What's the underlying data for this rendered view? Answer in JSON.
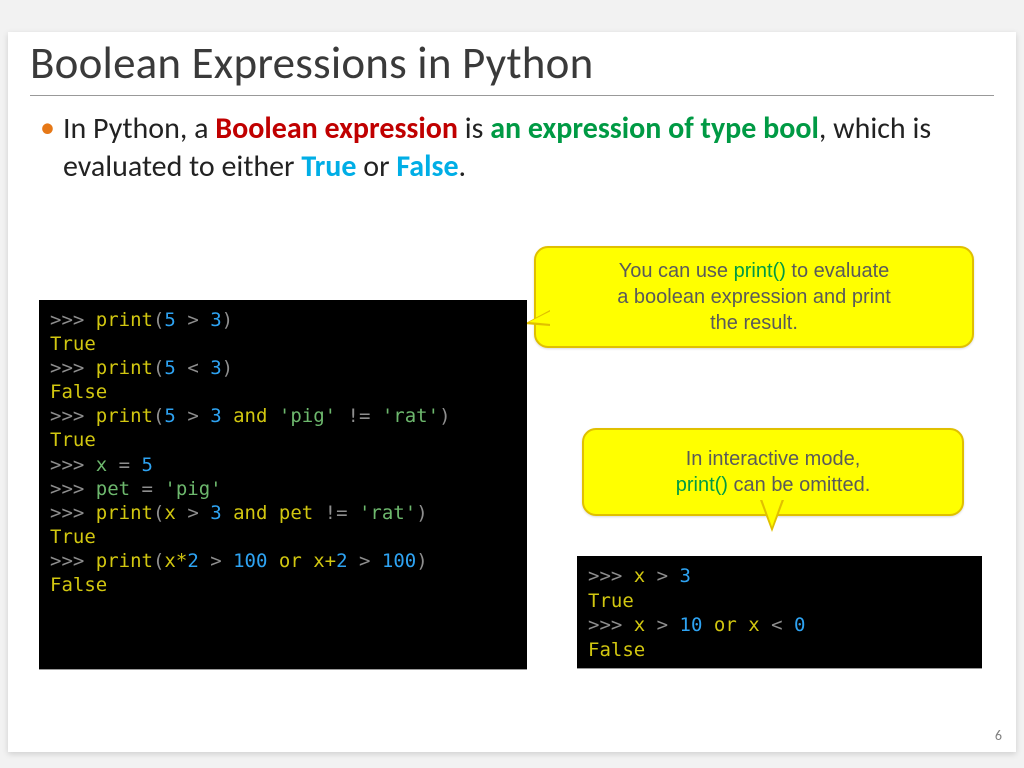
{
  "slide": {
    "title": "Boolean Expressions in Python",
    "page_number": "6"
  },
  "bullet": {
    "pre": "In Python, a ",
    "red": "Boolean expression",
    "mid1": " is ",
    "green1": "an expression of type bool",
    "mid2": ", which is evaluated to either ",
    "blue1": "True",
    "mid3": " or ",
    "blue2": "False",
    "end": "."
  },
  "callout1": {
    "line1_a": "You can use ",
    "line1_fn": "print()",
    "line1_b": " to evaluate",
    "line2": "a boolean expression and print",
    "line3": "the result."
  },
  "callout2": {
    "line1": "In interactive mode,",
    "line2_fn": "print()",
    "line2_b": " can be omitted."
  },
  "code_left": {
    "l1_prompt": ">>> ",
    "l1_fn": "print",
    "l1_paren_o": "(",
    "l1_n1": "5",
    "l1_op": " > ",
    "l1_n2": "3",
    "l1_paren_c": ")",
    "l2": "True",
    "l3_prompt": ">>> ",
    "l3_fn": "print",
    "l3_paren_o": "(",
    "l3_n1": "5",
    "l3_op": " < ",
    "l3_n2": "3",
    "l3_paren_c": ")",
    "l4": "False",
    "l5_prompt": ">>> ",
    "l5_fn": "print",
    "l5_paren_o": "(",
    "l5_n1": "5",
    "l5_op1": " > ",
    "l5_n2": "3",
    "l5_sp1": " ",
    "l5_kw1": "and",
    "l5_sp2": " ",
    "l5_s1": "'pig'",
    "l5_op2": " != ",
    "l5_s2": "'rat'",
    "l5_paren_c": ")",
    "l6": "True",
    "l7_prompt": ">>> ",
    "l7_var": "x",
    "l7_eq": " = ",
    "l7_n": "5",
    "l8_prompt": ">>> ",
    "l8_var": "pet",
    "l8_eq": " = ",
    "l8_s": "'pig'",
    "l9_prompt": ">>> ",
    "l9_fn": "print",
    "l9_paren_o": "(",
    "l9_v1": "x",
    "l9_op1": " > ",
    "l9_n1": "3",
    "l9_sp1": " ",
    "l9_kw": "and",
    "l9_sp2": " ",
    "l9_v2": "pet",
    "l9_op2": " != ",
    "l9_s": "'rat'",
    "l9_paren_c": ")",
    "l10": "True",
    "l11_prompt": ">>> ",
    "l11_fn": "print",
    "l11_paren_o": "(",
    "l11_a": "x*",
    "l11_n1": "2",
    "l11_op1": " > ",
    "l11_n2": "100",
    "l11_sp1": " ",
    "l11_kw": "or",
    "l11_sp2": " ",
    "l11_b": "x+",
    "l11_n3": "2",
    "l11_op2": " > ",
    "l11_n4": "100",
    "l11_paren_c": ")",
    "l12": "False"
  },
  "code_right": {
    "l1_prompt": ">>> ",
    "l1_v": "x",
    "l1_op": " > ",
    "l1_n": "3",
    "l2": "True",
    "l3_prompt": ">>> ",
    "l3_v1": "x",
    "l3_op1": " > ",
    "l3_n1": "10",
    "l3_sp1": " ",
    "l3_kw": "or",
    "l3_sp2": " ",
    "l3_v2": "x",
    "l3_op2": " < ",
    "l3_n2": "0",
    "l4": "False"
  }
}
